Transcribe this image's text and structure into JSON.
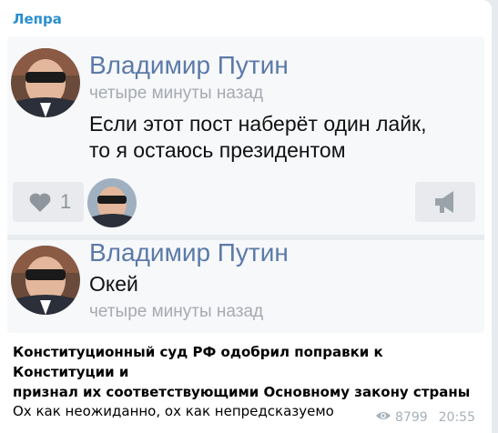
{
  "channel": {
    "name": "Лепра"
  },
  "post": {
    "author": "Владимир Путин",
    "time_ago": "четыре минуты назад",
    "text_line1": "Если этот пост наберёт один лайк,",
    "text_line2": "то я остаюсь президентом",
    "likes": "1"
  },
  "reply": {
    "author": "Владимир Путин",
    "text": "Окей",
    "time_ago": "четыре минуты назад"
  },
  "message": {
    "headline_line1": "Конституционный суд РФ одобрил поправки к Конституции и",
    "headline_line2": "признал их соответствующими Основному закону страны",
    "comment": "Ох как неожиданно, ох как непредсказуемо",
    "views": "8799",
    "time": "20:55"
  },
  "icons": {
    "like": "heart-icon",
    "share": "megaphone-icon",
    "views": "eye-icon"
  },
  "colors": {
    "channel": "#2a8fd0",
    "author": "#5c7aa8",
    "muted": "#a6aab0"
  }
}
